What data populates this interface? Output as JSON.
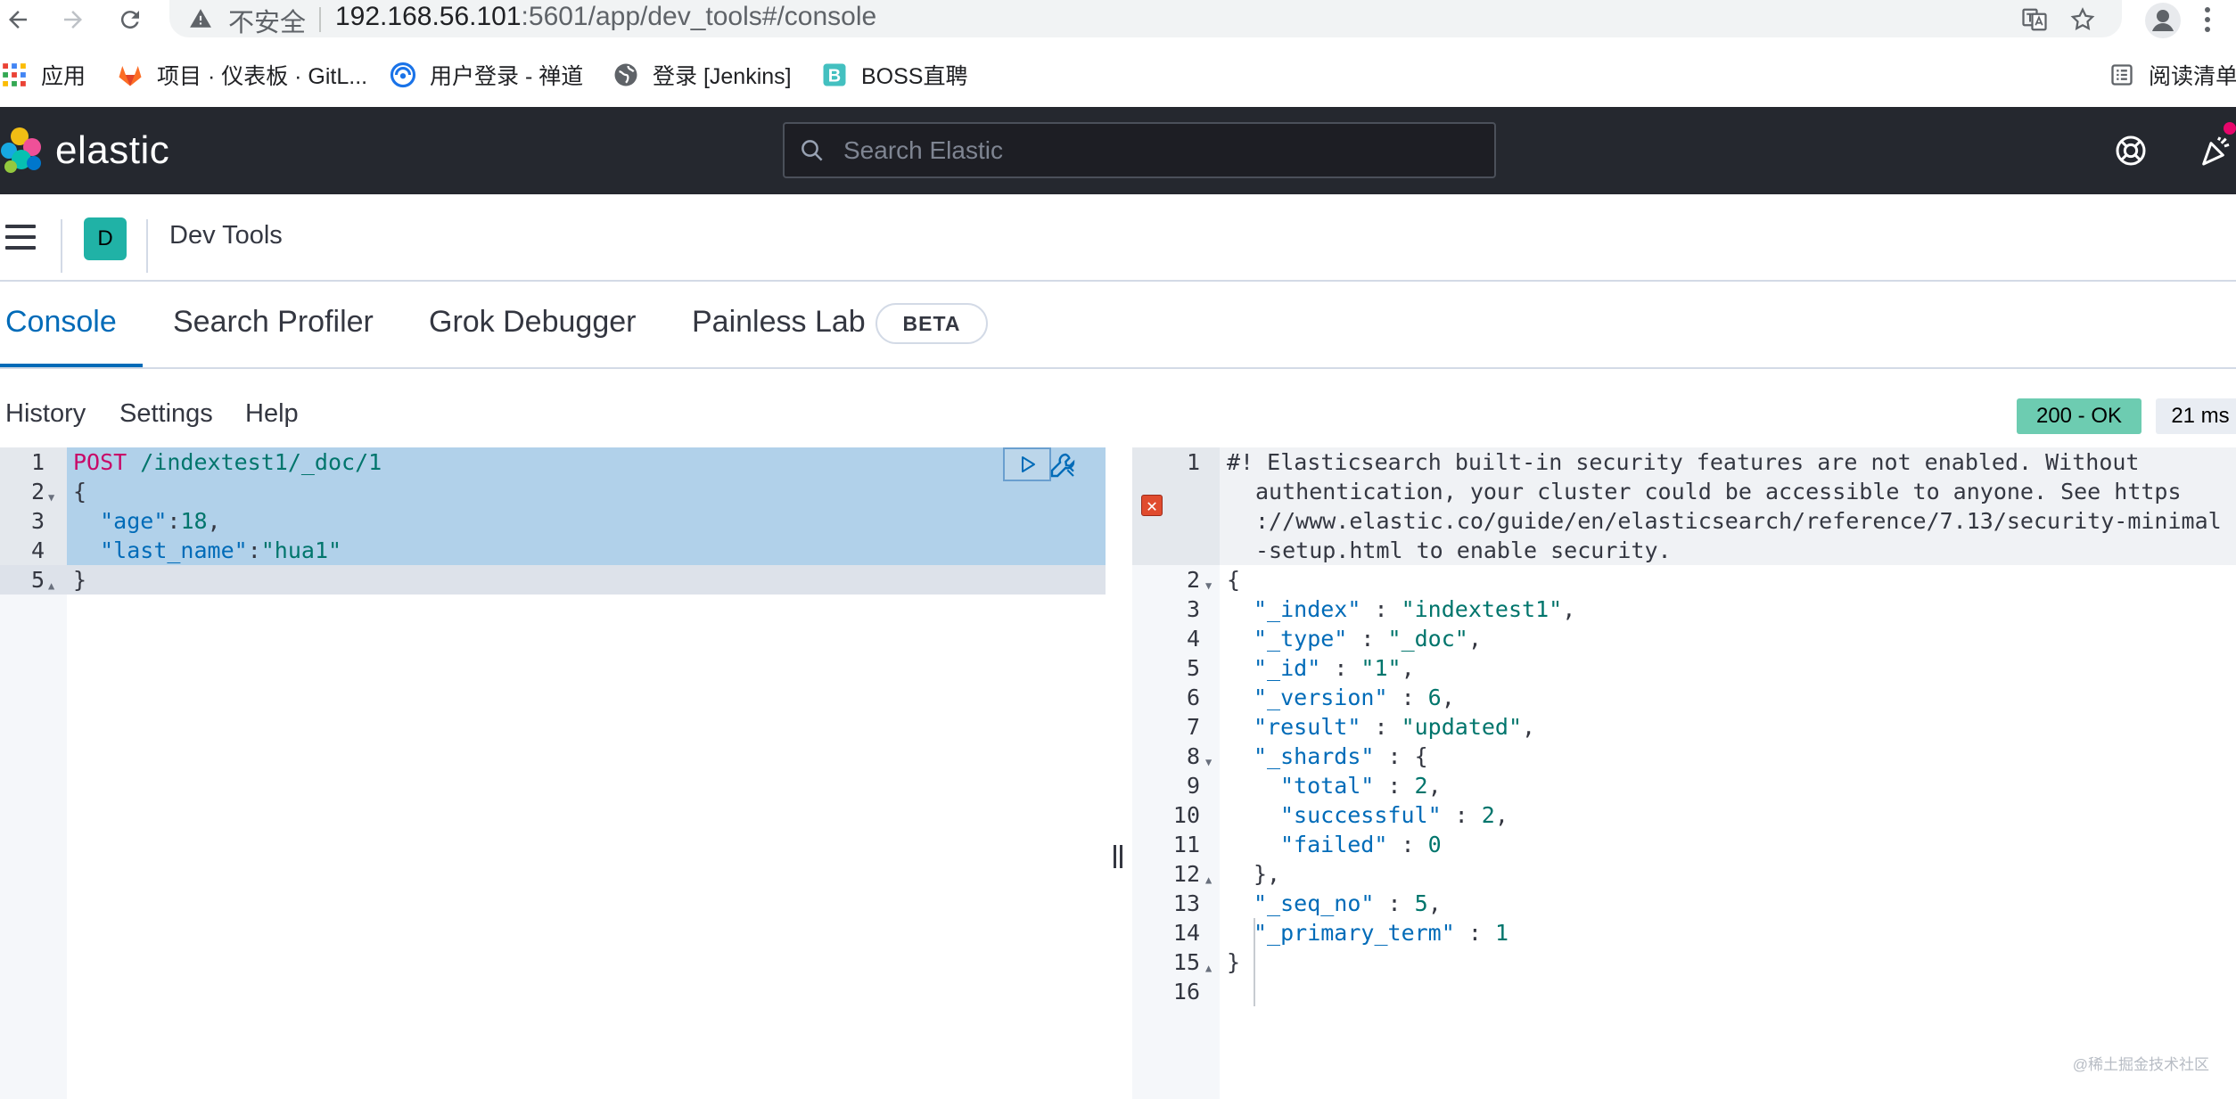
{
  "browser": {
    "security_label": "不安全",
    "url_host": "192.168.56.101",
    "url_path": ":5601/app/dev_tools#/console",
    "bookmarks": [
      {
        "label": "应用",
        "icon": "apps-grid-icon"
      },
      {
        "label": "项目 · 仪表板 · GitL...",
        "icon": "gitlab-icon"
      },
      {
        "label": "用户登录 - 禅道",
        "icon": "zentao-icon"
      },
      {
        "label": "登录 [Jenkins]",
        "icon": "globe-icon"
      },
      {
        "label": "BOSS直聘",
        "icon": "boss-icon"
      }
    ],
    "reading_list": "阅读清单"
  },
  "kibana": {
    "brand": "elastic",
    "search_placeholder": "Search Elastic",
    "space_initial": "D",
    "breadcrumb": "Dev Tools",
    "accent": "#006bb8"
  },
  "tabs": [
    {
      "label": "Console",
      "active": true
    },
    {
      "label": "Search Profiler",
      "active": false
    },
    {
      "label": "Grok Debugger",
      "active": false
    },
    {
      "label": "Painless Lab",
      "active": false
    }
  ],
  "beta_badge": "BETA",
  "console_menu": {
    "history": "History",
    "settings": "Settings",
    "help": "Help"
  },
  "response_status": {
    "code": "200 - OK",
    "time": "21 ms",
    "status_color": "#6dccb1"
  },
  "request_lines": [
    {
      "num": "1",
      "text_a": "POST",
      "text_b": " /indextest1/_doc/1"
    },
    {
      "num": "2",
      "text": "{"
    },
    {
      "num": "3",
      "key": "\"age\"",
      "sep": ":",
      "value": "18",
      "tail": ","
    },
    {
      "num": "4",
      "key": "\"last_name\"",
      "sep": ":",
      "value": "\"hua1\""
    },
    {
      "num": "5",
      "text": "}"
    }
  ],
  "response_comment": [
    "#! Elasticsearch built-in security features are not enabled. Without",
    "authentication, your cluster could be accessible to anyone. See https",
    "://www.elastic.co/guide/en/elasticsearch/reference/7.13/security-minimal",
    "-setup.html to enable security."
  ],
  "response_lines": [
    {
      "num": "2",
      "text": "{"
    },
    {
      "num": "3",
      "key": "\"_index\"",
      "value": "\"indextest1\"",
      "tail": ","
    },
    {
      "num": "4",
      "key": "\"_type\"",
      "value": "\"_doc\"",
      "tail": ","
    },
    {
      "num": "5",
      "key": "\"_id\"",
      "value": "\"1\"",
      "tail": ","
    },
    {
      "num": "6",
      "key": "\"_version\"",
      "value": "6",
      "tail": ","
    },
    {
      "num": "7",
      "key": "\"result\"",
      "value": "\"updated\"",
      "tail": ","
    },
    {
      "num": "8",
      "key": "\"_shards\"",
      "value": "{",
      "tail": ""
    },
    {
      "num": "9",
      "key": "\"total\"",
      "value": "2",
      "tail": ","
    },
    {
      "num": "10",
      "key": "\"successful\"",
      "value": "2",
      "tail": ","
    },
    {
      "num": "11",
      "key": "\"failed\"",
      "value": "0",
      "tail": ""
    },
    {
      "num": "12",
      "text": "},"
    },
    {
      "num": "13",
      "key": "\"_seq_no\"",
      "value": "5",
      "tail": ","
    },
    {
      "num": "14",
      "key": "\"_primary_term\"",
      "value": "1",
      "tail": ""
    },
    {
      "num": "15",
      "text": "}"
    },
    {
      "num": "16",
      "text": ""
    }
  ],
  "response_first_num": "1",
  "watermark": "@稀土掘金技术社区"
}
